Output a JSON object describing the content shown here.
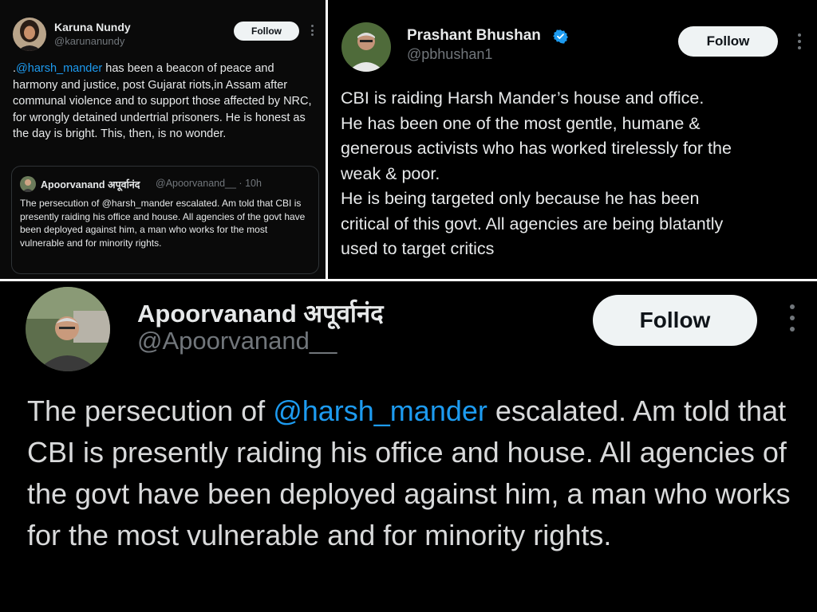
{
  "tweet_left": {
    "name": "Karuna Nundy",
    "handle": "@karunanundy",
    "follow_label": "Follow",
    "text_prefix": ".",
    "mention": "@harsh_mander",
    "text_rest": " has been a beacon of peace and harmony and justice, post Gujarat riots,in Assam after communal violence and to support those affected by NRC, for wrongly detained undertrial prisoners. He is honest as the day is bright. This, then, is no wonder.",
    "quote": {
      "name": "Apoorvanand अपूर्वानंद",
      "handle_time": "@Apoorvanand__ · 10h",
      "text": "The persecution of @harsh_mander escalated. Am told that CBI is presently raiding his office and house. All agencies of the govt have been deployed against him, a man who works for the most vulnerable and for minority rights."
    },
    "avatar_icon": "profile-photo-icon"
  },
  "tweet_right": {
    "name": "Prashant Bhushan",
    "handle": "@pbhushan1",
    "follow_label": "Follow",
    "verified_icon": "verified-badge-icon",
    "lines": [
      "CBI is raiding Harsh Mander’s house and office.",
      "He has been one of the most gentle, humane &",
      "generous activists who has worked tirelessly for the",
      "weak & poor.",
      "He is being targeted only because he has been",
      "critical of this govt. All agencies are being blatantly",
      "used to target critics"
    ]
  },
  "tweet_bottom": {
    "name": "Apoorvanand अपूर्वानंद",
    "handle": "@Apoorvanand__",
    "follow_label": "Follow",
    "text_prefix": "The persecution of ",
    "mention": "@harsh_mander",
    "text_rest": " escalated. Am told that CBI is presently raiding his office and house. All agencies of the govt have been deployed against him, a man who works for the most vulnerable and for minority rights."
  },
  "colors": {
    "background": "#000000",
    "text": "#e7e9ea",
    "muted": "#71767b",
    "mention": "#1d9bf0",
    "follow_button": "#eff3f4"
  }
}
